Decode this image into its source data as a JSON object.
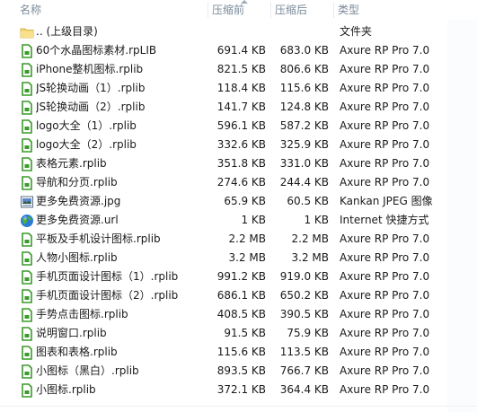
{
  "columns": {
    "name": "名称",
    "size": "压缩前",
    "compressed": "压缩后",
    "type": "类型"
  },
  "rows": [
    {
      "name": ".. (上级目录)",
      "size": "",
      "compressed": "",
      "type": "文件夹",
      "icon": "folder-icon"
    },
    {
      "name": "60个水晶图标素材.rpLIB",
      "size": "691.4 KB",
      "compressed": "683.0 KB",
      "type": "Axure RP Pro 7.0",
      "icon": "rplib-file-icon"
    },
    {
      "name": "iPhone整机图标.rplib",
      "size": "821.5 KB",
      "compressed": "806.6 KB",
      "type": "Axure RP Pro 7.0",
      "icon": "rplib-file-icon"
    },
    {
      "name": "JS轮换动画（1）.rplib",
      "size": "118.4 KB",
      "compressed": "115.6 KB",
      "type": "Axure RP Pro 7.0",
      "icon": "rplib-file-icon"
    },
    {
      "name": "JS轮换动画（2）.rplib",
      "size": "141.7 KB",
      "compressed": "124.8 KB",
      "type": "Axure RP Pro 7.0",
      "icon": "rplib-file-icon"
    },
    {
      "name": "logo大全（1）.rplib",
      "size": "596.1 KB",
      "compressed": "587.2 KB",
      "type": "Axure RP Pro 7.0",
      "icon": "rplib-file-icon"
    },
    {
      "name": "logo大全（2）.rplib",
      "size": "332.6 KB",
      "compressed": "325.9 KB",
      "type": "Axure RP Pro 7.0",
      "icon": "rplib-file-icon"
    },
    {
      "name": "表格元素.rplib",
      "size": "351.8 KB",
      "compressed": "331.0 KB",
      "type": "Axure RP Pro 7.0",
      "icon": "rplib-file-icon"
    },
    {
      "name": "导航和分页.rplib",
      "size": "274.6 KB",
      "compressed": "244.4 KB",
      "type": "Axure RP Pro 7.0",
      "icon": "rplib-file-icon"
    },
    {
      "name": "更多免费资源.jpg",
      "size": "65.9 KB",
      "compressed": "60.5 KB",
      "type": "Kankan JPEG 图像",
      "icon": "jpeg-file-icon"
    },
    {
      "name": "更多免费资源.url",
      "size": "1 KB",
      "compressed": "1 KB",
      "type": "Internet 快捷方式",
      "icon": "globe-icon"
    },
    {
      "name": "平板及手机设计图标.rplib",
      "size": "2.2 MB",
      "compressed": "2.2 MB",
      "type": "Axure RP Pro 7.0",
      "icon": "rplib-file-icon"
    },
    {
      "name": "人物小图标.rplib",
      "size": "3.2 MB",
      "compressed": "3.2 MB",
      "type": "Axure RP Pro 7.0",
      "icon": "rplib-file-icon"
    },
    {
      "name": "手机页面设计图标（1）.rplib",
      "size": "991.2 KB",
      "compressed": "919.0 KB",
      "type": "Axure RP Pro 7.0",
      "icon": "rplib-file-icon"
    },
    {
      "name": "手机页面设计图标（2）.rplib",
      "size": "686.1 KB",
      "compressed": "650.2 KB",
      "type": "Axure RP Pro 7.0",
      "icon": "rplib-file-icon"
    },
    {
      "name": "手势点击图标.rplib",
      "size": "408.5 KB",
      "compressed": "390.5 KB",
      "type": "Axure RP Pro 7.0",
      "icon": "rplib-file-icon"
    },
    {
      "name": "说明窗口.rplib",
      "size": "91.5 KB",
      "compressed": "75.9 KB",
      "type": "Axure RP Pro 7.0",
      "icon": "rplib-file-icon"
    },
    {
      "name": "图表和表格.rplib",
      "size": "115.6 KB",
      "compressed": "113.5 KB",
      "type": "Axure RP Pro 7.0",
      "icon": "rplib-file-icon"
    },
    {
      "name": "小图标（黑白）.rplib",
      "size": "893.5 KB",
      "compressed": "766.7 KB",
      "type": "Axure RP Pro 7.0",
      "icon": "rplib-file-icon"
    },
    {
      "name": "小图标.rplib",
      "size": "372.1 KB",
      "compressed": "364.4 KB",
      "type": "Axure RP Pro 7.0",
      "icon": "rplib-file-icon"
    }
  ],
  "colors": {
    "header_text": "#7a8a99",
    "rplib_icon": "#3a9a2a",
    "folder_icon": "#f5d36b"
  }
}
